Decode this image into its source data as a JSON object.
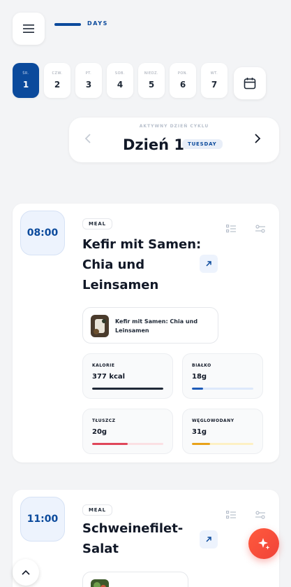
{
  "header": {
    "section_label": "DAYS"
  },
  "days": [
    {
      "name": "ŚR.",
      "num": "1",
      "active": true
    },
    {
      "name": "CZW.",
      "num": "2"
    },
    {
      "name": "PT.",
      "num": "3"
    },
    {
      "name": "SOB.",
      "num": "4"
    },
    {
      "name": "NIEDZ.",
      "num": "5"
    },
    {
      "name": "PON.",
      "num": "6"
    },
    {
      "name": "WT.",
      "num": "7"
    }
  ],
  "cycle": {
    "subtitle": "AKTYWNY DZIEŃ CYKLU",
    "title": "Dzień 1",
    "weekday": "TUESDAY"
  },
  "meals": [
    {
      "time": "08:00",
      "tag": "MEAL",
      "title": "Kefir mit Samen: Chia und Leinsamen",
      "ingredient": "Kefir mit Samen: Chia und Leinsamen",
      "stats": {
        "calories": {
          "label": "KALORIE",
          "value": "377 kcal",
          "fill": 1.0
        },
        "protein": {
          "label": "BIAŁKO",
          "value": "18g",
          "fill": 0.18
        },
        "fat": {
          "label": "TŁUSZCZ",
          "value": "20g",
          "fill": 0.5
        },
        "carbs": {
          "label": "WĘGLOWODANY",
          "value": "31g",
          "fill": 0.3
        }
      }
    },
    {
      "time": "11:00",
      "tag": "MEAL",
      "title": "Schweinefilet-Salat"
    }
  ],
  "colors": {
    "primary": "#0b4a9c",
    "calories": "#1f2937",
    "protein": "#1e5bb8",
    "fat": "#e0465a",
    "carbs": "#e8a21a",
    "ai_button": "#f0433a"
  },
  "icons": [
    "menu-icon",
    "calendar-icon",
    "chevron-left-icon",
    "chevron-right-icon",
    "list-icon",
    "sliders-icon",
    "arrow-up-right-icon",
    "chevron-up-icon",
    "sparkle-icon"
  ]
}
